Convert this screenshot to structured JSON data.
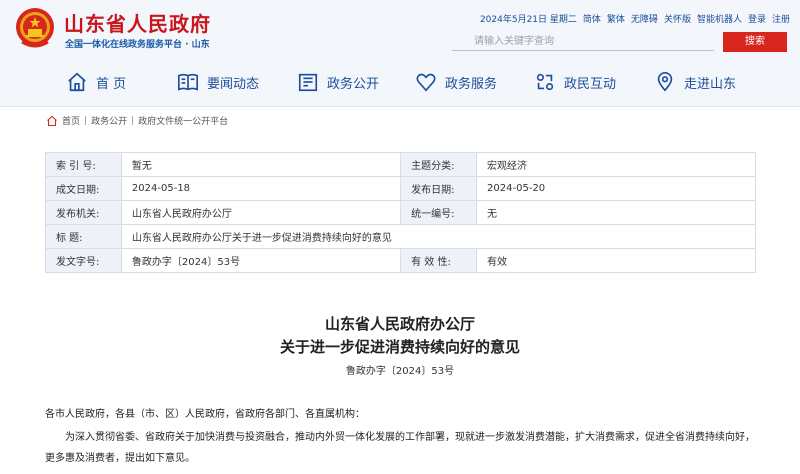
{
  "header": {
    "site_title": "山东省人民政府",
    "site_subtitle": "全国一体化在线政务服务平台 · 山东",
    "date": "2024年5月21日 星期二",
    "links": [
      "简体",
      "繁体",
      "无障碍",
      "关怀版",
      "智能机器人",
      "登录",
      "注册"
    ],
    "search_placeholder": "请输入关键字查询",
    "search_button": "搜索",
    "colors": {
      "brand_red": "#c8161d",
      "link_blue": "#1b4e9b"
    }
  },
  "nav": {
    "items": [
      {
        "label": "首 页",
        "icon": "home-icon"
      },
      {
        "label": "要闻动态",
        "icon": "news-icon"
      },
      {
        "label": "政务公开",
        "icon": "building-icon"
      },
      {
        "label": "政务服务",
        "icon": "heart-icon"
      },
      {
        "label": "政民互动",
        "icon": "interaction-icon"
      },
      {
        "label": "走进山东",
        "icon": "location-icon"
      }
    ]
  },
  "breadcrumb": [
    "首页",
    "政务公开",
    "政府文件统一公开平台"
  ],
  "info": {
    "index_label": "索 引 号:",
    "index_value": "暂无",
    "topic_label": "主题分类:",
    "topic_value": "宏观经济",
    "made_label": "成文日期:",
    "made_value": "2024-05-18",
    "publish_label": "发布日期:",
    "publish_value": "2024-05-20",
    "org_label": "发布机关:",
    "org_value": "山东省人民政府办公厅",
    "code_label": "统一编号:",
    "code_value": "无",
    "title_label": "标 题:",
    "title_value": "山东省人民政府办公厅关于进一步促进消费持续向好的意见",
    "docno_label": "发文字号:",
    "docno_value": "鲁政办字〔2024〕53号",
    "valid_label": "有 效 性:",
    "valid_value": "有效"
  },
  "article": {
    "title_line1": "山东省人民政府办公厅",
    "title_line2": "关于进一步促进消费持续向好的意见",
    "doc_number": "鲁政办字〔2024〕53号",
    "salutation": "各市人民政府，各县（市、区）人民政府，省政府各部门、各直属机构：",
    "intro": "为深入贯彻省委、省政府关于加快消费与投资融合，推动内外贸一体化发展的工作部署，现就进一步激发消费潜能，扩大消费需求，促进全省消费持续向好，更多惠及消费者，提出如下意见。"
  }
}
